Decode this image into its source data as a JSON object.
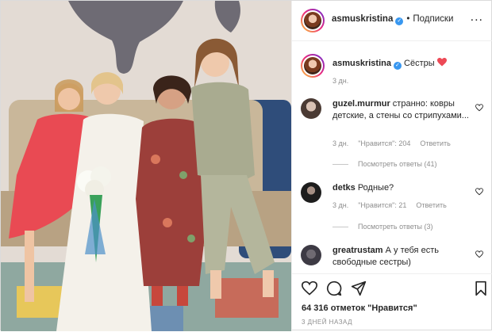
{
  "post": {
    "author": "asmuskristina",
    "follow_label": "Подписки",
    "dot": "•",
    "more": "...",
    "caption_text": "Сёстры",
    "caption_time": "3 дн.",
    "verified_mark": "✓"
  },
  "comments": [
    {
      "user": "guzel.murmur",
      "text": "странно: ковры детские, а стены со стрипухами...",
      "time": "3 дн.",
      "likes": "\"Нравится\": 204",
      "reply": "Ответить",
      "view_replies": "Посмотреть ответы (41)"
    },
    {
      "user": "detks",
      "text": "Родные?",
      "time": "3 дн.",
      "likes": "\"Нравится\": 21",
      "reply": "Ответить",
      "view_replies": "Посмотреть ответы (3)"
    },
    {
      "user": "greatrustam",
      "text": "А у тебя есть свободные сестры)"
    }
  ],
  "footer": {
    "likes_text": "64 316 отметок \"Нравится\"",
    "time_ago": "3 ДНЕЙ НАЗАД"
  },
  "icons": {
    "like": "heart-icon",
    "comment": "comment-icon",
    "share": "share-icon",
    "save": "bookmark-icon",
    "more": "more-options-icon"
  },
  "colors": {
    "link_blue": "#3897f0",
    "caption_heart": "#ed4956",
    "muted_text": "#8e8e8e"
  }
}
